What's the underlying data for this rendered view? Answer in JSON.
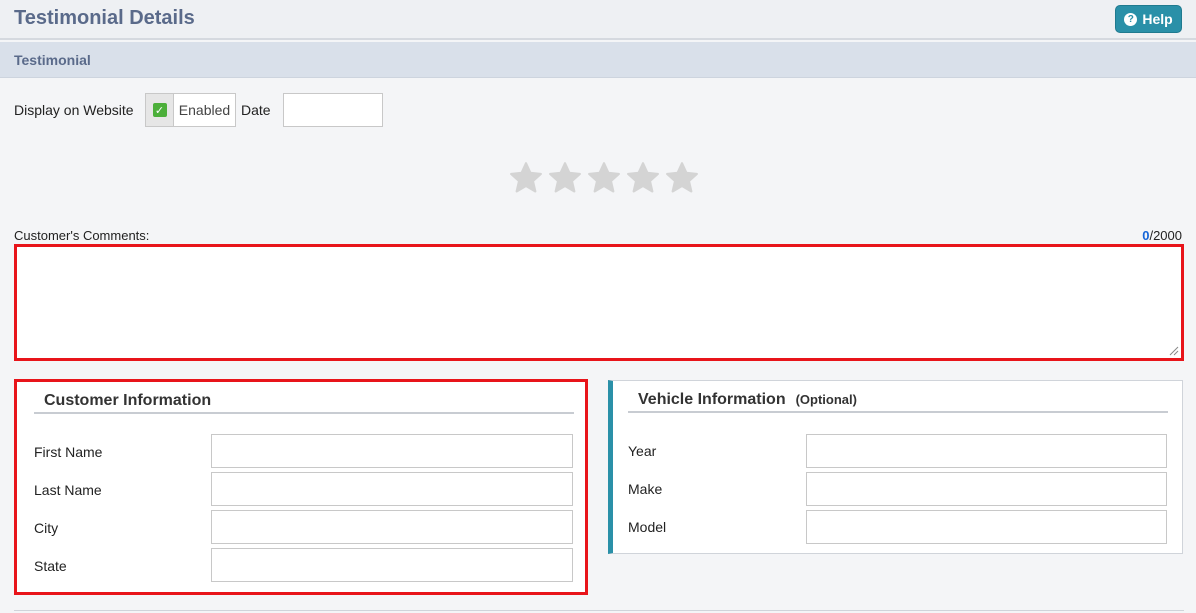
{
  "header": {
    "title": "Testimonial Details",
    "help_label": "Help",
    "help_icon": "question-circle-icon"
  },
  "section": {
    "title": "Testimonial"
  },
  "display": {
    "label": "Display on Website",
    "enabled_label": "Enabled",
    "enabled_checked": true,
    "date_label": "Date",
    "date_value": ""
  },
  "rating": {
    "max": 5,
    "value": 0,
    "empty_color": "#d4d4d4"
  },
  "comments": {
    "label": "Customer's Comments:",
    "count": "0",
    "max": "/2000",
    "value": ""
  },
  "customer": {
    "heading": "Customer Information",
    "fields": [
      {
        "label": "First Name",
        "value": ""
      },
      {
        "label": "Last Name",
        "value": ""
      },
      {
        "label": "City",
        "value": ""
      },
      {
        "label": "State",
        "value": ""
      }
    ]
  },
  "vehicle": {
    "heading": "Vehicle Information",
    "optional_label": "(Optional)",
    "fields": [
      {
        "label": "Year",
        "value": ""
      },
      {
        "label": "Make",
        "value": ""
      },
      {
        "label": "Model",
        "value": ""
      }
    ]
  },
  "colors": {
    "accent": "#2a90a8",
    "highlight_border": "#e8141a",
    "title": "#5a6a8a",
    "counter": "#1565d8",
    "checkbox": "#4caf3a"
  }
}
